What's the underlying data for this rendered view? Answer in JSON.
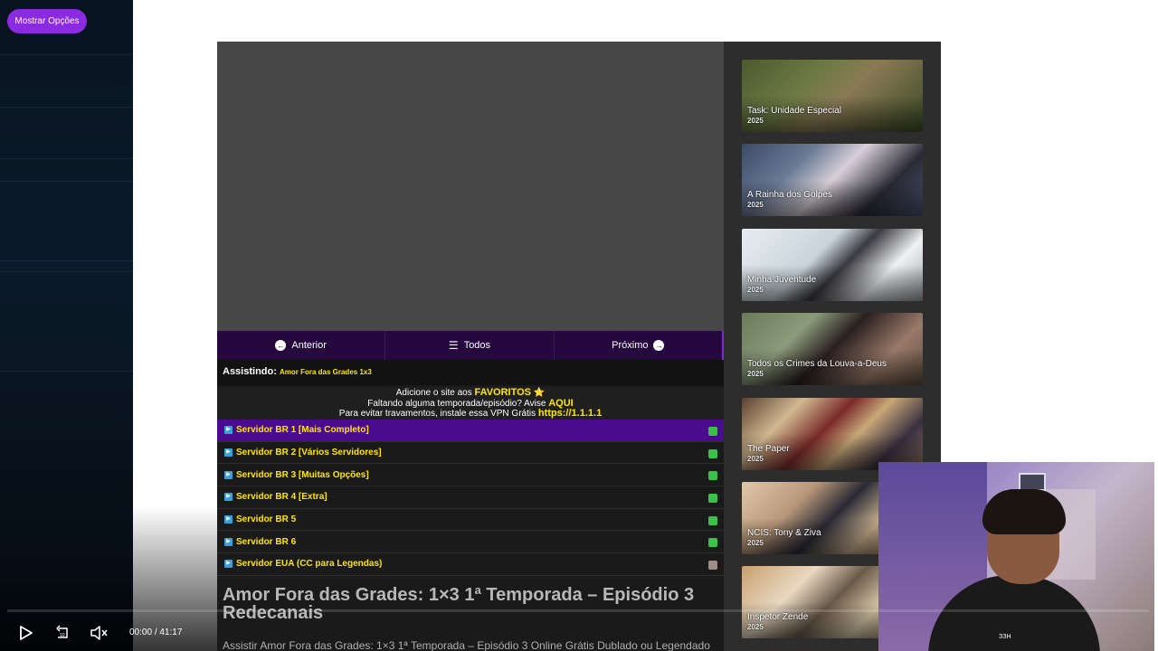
{
  "overlay": {
    "show_options_label": "Mostrar Opções"
  },
  "nav": {
    "prev": "Anterior",
    "all": "Todos",
    "next": "Próximo"
  },
  "watching": {
    "label": "Assistindo:",
    "episode": "Amor Fora das Grades 1x3"
  },
  "notice": {
    "line1_prefix": "Adicione o site aos ",
    "line1_highlight": "FAVORITOS",
    "line1_star": "⭐",
    "line2_prefix": "Faltando alguma temporada/episódio? Avise ",
    "line2_highlight": "AQUI",
    "line3_prefix": "Para evitar travamentos, instale essa VPN Grátis ",
    "line3_highlight": "https://1.1.1.1"
  },
  "servers": [
    {
      "label": "Servidor BR 1 [Mais Completo]",
      "status_color": "#3cc24a"
    },
    {
      "label": "Servidor BR 2 [Vários Servidores]",
      "status_color": "#3cc24a"
    },
    {
      "label": "Servidor BR 3 [Muitas Opções]",
      "status_color": "#3cc24a"
    },
    {
      "label": "Servidor BR 4 [Extra]",
      "status_color": "#3cc24a"
    },
    {
      "label": "Servidor BR 5",
      "status_color": "#3cc24a"
    },
    {
      "label": "Servidor BR 6",
      "status_color": "#3cc24a"
    },
    {
      "label": "Servidor EUA (CC para Legendas)",
      "status_color": "#a08a8a"
    }
  ],
  "episode": {
    "title": "Amor Fora das Grades: 1×3 1ª Temporada – Episódio 3 Redecanais",
    "description": "Assistir Amor Fora das Grades: 1×3 1ª Temporada – Episódio 3 Online Grátis Dublado ou Legendado"
  },
  "sidebar": [
    {
      "title": "Task: Unidade Especial",
      "year": "2025"
    },
    {
      "title": "A Rainha dos Golpes",
      "year": "2025"
    },
    {
      "title": "Minha Juventude",
      "year": "2025"
    },
    {
      "title": "Todos os Crimes da Louva-a-Deus",
      "year": "2025"
    },
    {
      "title": "The Paper",
      "year": "2025"
    },
    {
      "title": "NCIS: Tony & Ziva",
      "year": "2025"
    },
    {
      "title": "Inspetor Zende",
      "year": "2025"
    }
  ],
  "player": {
    "current_time": "00:00",
    "separator": "/",
    "duration": "41:17"
  },
  "webcam": {
    "shirt_text": "ЗЗН"
  }
}
